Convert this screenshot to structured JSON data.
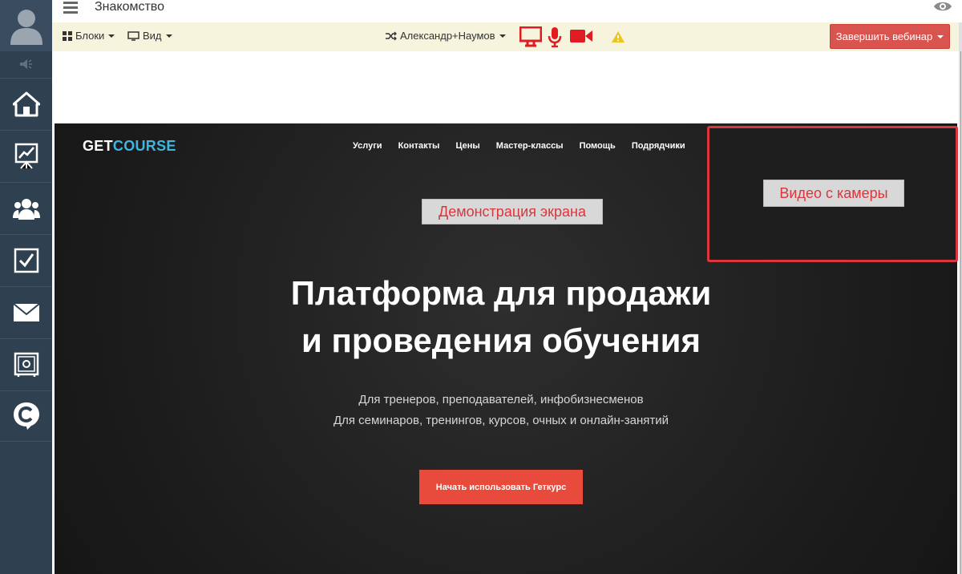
{
  "header": {
    "title": "Знакомство"
  },
  "toolbar": {
    "blocks_label": "Блоки",
    "view_label": "Вид",
    "presenter_label": "Александр+Наумов",
    "end_webinar_label": "Завершить вебинар"
  },
  "sidebar": {
    "items": [
      {
        "icon": "home-icon"
      },
      {
        "icon": "chart-board-icon"
      },
      {
        "icon": "users-icon"
      },
      {
        "icon": "checkbox-icon"
      },
      {
        "icon": "mail-icon"
      },
      {
        "icon": "safe-icon"
      },
      {
        "icon": "chat-c-icon"
      }
    ]
  },
  "screen_share": {
    "label": "Демонстрация экрана",
    "logo_part1": "GET",
    "logo_part2": "COURSE",
    "nav": [
      "Услуги",
      "Контакты",
      "Цены",
      "Мастер-классы",
      "Помощь",
      "Подрядчики"
    ],
    "headline_line1": "Платформа для продажи",
    "headline_line2": "и проведения обучения",
    "subtitle_line1": "Для тренеров, преподавателей, инфобизнесменов",
    "subtitle_line2": "Для семинаров, тренингов, курсов, очных и онлайн-занятий",
    "cta_label": "Начать использовать Геткурс"
  },
  "camera": {
    "label": "Видео с камеры"
  },
  "colors": {
    "sidebar_bg": "#2f4050",
    "toolbar_bg": "#f6f4dd",
    "accent_red": "#d9363e",
    "end_button": "#d9534f",
    "logo_blue": "#3fb6e0",
    "warning_yellow": "#f0c419"
  }
}
